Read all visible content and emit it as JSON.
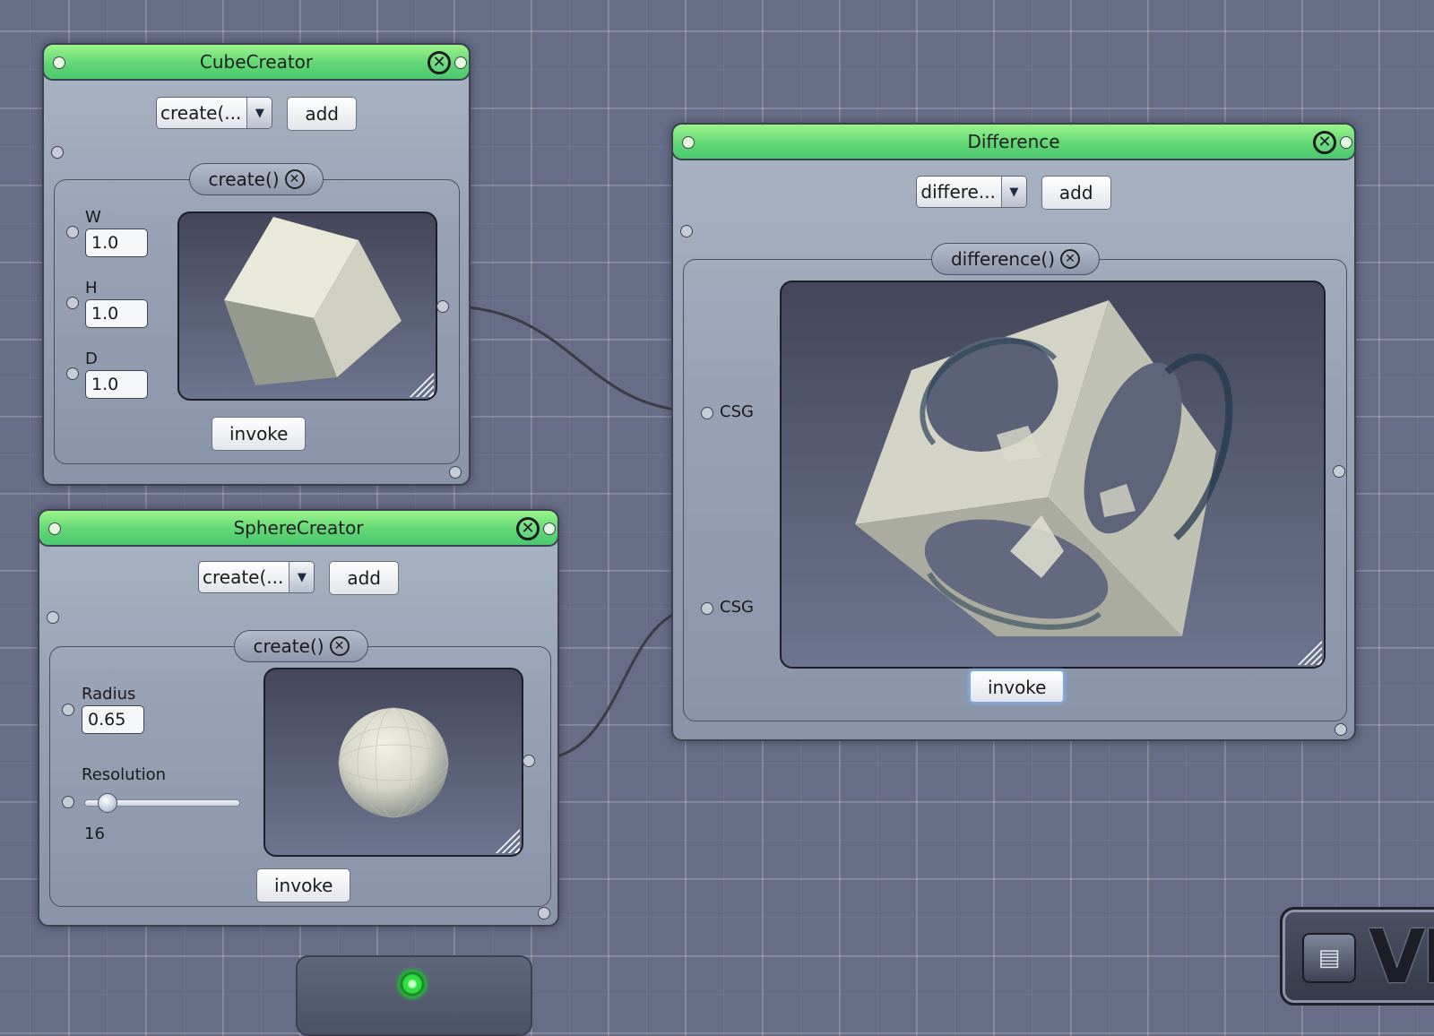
{
  "cube_window": {
    "title": "CubeCreator",
    "method_select": "create(...",
    "add_label": "add",
    "group_title": "create()",
    "inputs": [
      {
        "label": "W",
        "value": "1.0"
      },
      {
        "label": "H",
        "value": "1.0"
      },
      {
        "label": "D",
        "value": "1.0"
      }
    ],
    "invoke_label": "invoke"
  },
  "sphere_window": {
    "title": "SphereCreator",
    "method_select": "create(...",
    "add_label": "add",
    "group_title": "create()",
    "radius_label": "Radius",
    "radius_value": "0.65",
    "resolution_label": "Resolution",
    "resolution_value": "16",
    "resolution_fraction": 0.15,
    "invoke_label": "invoke"
  },
  "difference_window": {
    "title": "Difference",
    "method_select": "differe...",
    "add_label": "add",
    "group_title": "difference()",
    "input_labels": [
      "CSG",
      "CSG"
    ],
    "invoke_label": "invoke"
  },
  "icons": {
    "close": "close-circle-icon",
    "dropdown": "chevron-down-icon",
    "status": "green-status-light-icon"
  },
  "logo": {
    "text": "VI"
  },
  "colors": {
    "titlebar_green": "#5fd877",
    "canvas_background": "#676d86",
    "wire": "#3a3d44",
    "status_green": "#2fe03d"
  }
}
